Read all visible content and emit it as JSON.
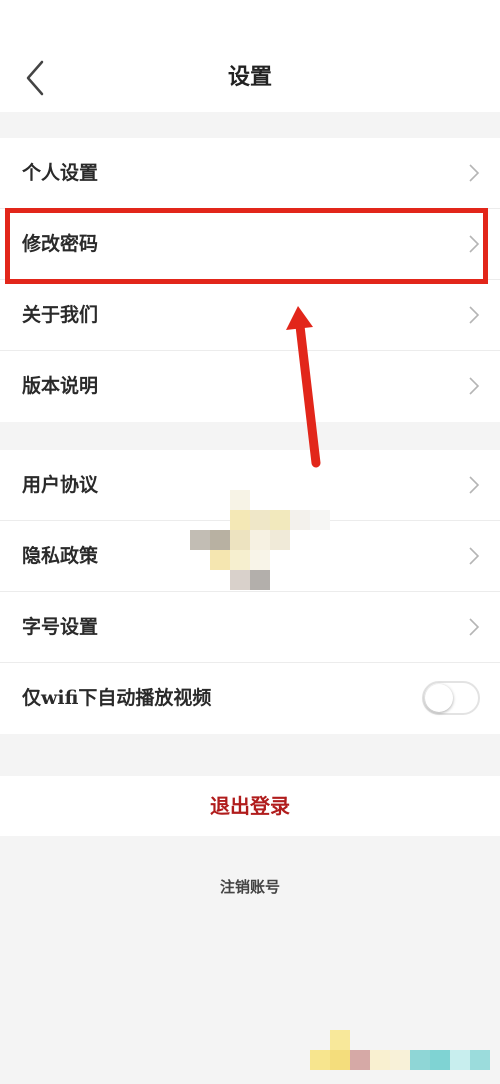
{
  "header": {
    "title": "设置"
  },
  "groups": [
    {
      "items": [
        {
          "label": "个人设置"
        },
        {
          "label": "修改密码"
        },
        {
          "label": "关于我们"
        },
        {
          "label": "版本说明"
        }
      ]
    },
    {
      "items": [
        {
          "label": "用户协议"
        },
        {
          "label": "隐私政策"
        },
        {
          "label": "字号设置"
        }
      ]
    }
  ],
  "wifi_autoplay": {
    "label": "仅wifi下自动播放视频",
    "enabled": false
  },
  "logout_label": "退出登录",
  "delete_account_label": "注销账号",
  "colors": {
    "accent_red": "#b01c1c",
    "annotation_red": "#e2261a",
    "background": "#f4f4f4"
  }
}
